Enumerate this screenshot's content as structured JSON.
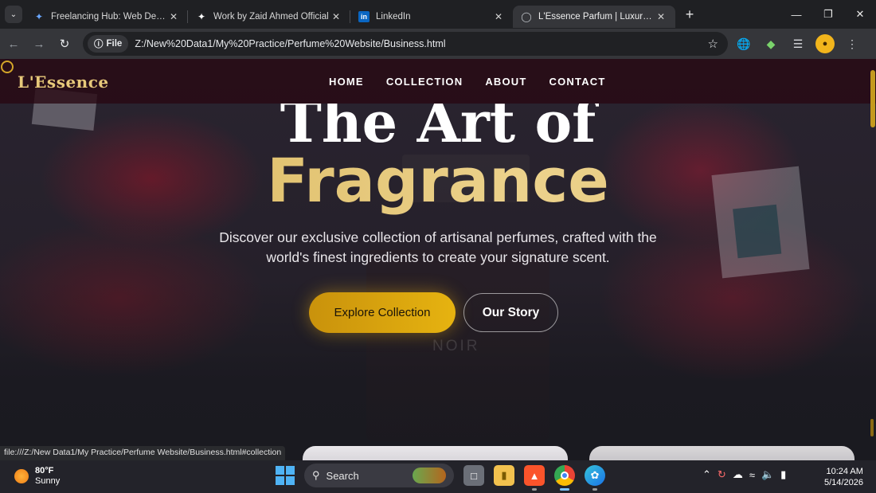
{
  "browser": {
    "tabs": [
      {
        "title": "Freelancing Hub: Web Dev & Yo",
        "favicon": "gemini-sparkle-icon",
        "active": false
      },
      {
        "title": "Work by Zaid Ahmed Official",
        "favicon": "sparkle-icon",
        "active": false
      },
      {
        "title": "LinkedIn",
        "favicon": "linkedin-icon",
        "active": false
      },
      {
        "title": "L'Essence Parfum | Luxury Fragr",
        "favicon": "globe-icon",
        "active": true
      }
    ],
    "site_chip": "File",
    "url": "Z:/New%20Data1/My%20Practice/Perfume%20Website/Business.html",
    "status_url": "file:///Z:/New Data1/My Practice/Perfume Website/Business.html#collection"
  },
  "site": {
    "logo": "L'Essence",
    "nav": [
      "HOME",
      "COLLECTION",
      "ABOUT",
      "CONTACT"
    ],
    "hero_line1": "The Art of",
    "hero_line2": "Fragrance",
    "hero_desc": "Discover our exclusive collection of artisanal perfumes, crafted with the world's finest ingredients to create your signature scent.",
    "primary_cta": "Explore Collection",
    "secondary_cta": "Our Story",
    "bottle_label": "NOIR"
  },
  "taskbar": {
    "temperature": "80°F",
    "condition": "Sunny",
    "search_label": "Search",
    "time": "10:24 AM",
    "date": "5/14/2026"
  },
  "colors": {
    "gold": "#e3c77b",
    "accent": "#e6b310",
    "nav_bg": "#28081a"
  }
}
